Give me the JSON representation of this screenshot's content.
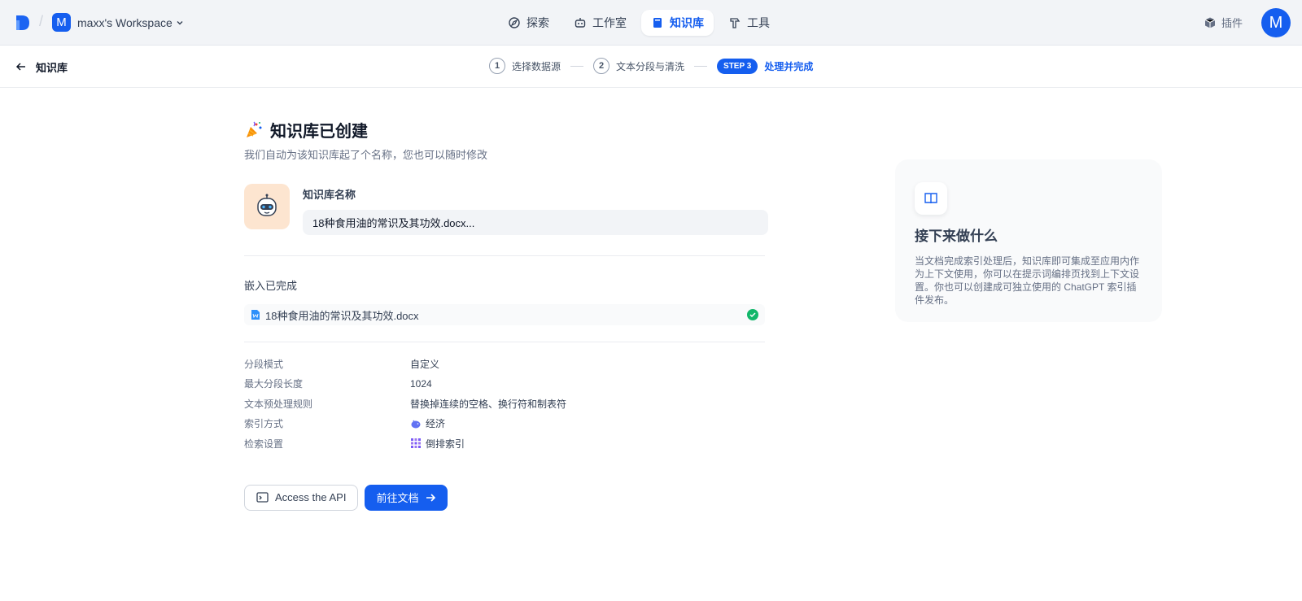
{
  "topbar": {
    "workspace_initial": "M",
    "workspace_name": "maxx's Workspace",
    "nav": [
      {
        "label": "探索",
        "icon": "compass-icon"
      },
      {
        "label": "工作室",
        "icon": "robot-icon"
      },
      {
        "label": "知识库",
        "icon": "book-icon",
        "active": true
      },
      {
        "label": "工具",
        "icon": "hammer-icon"
      }
    ],
    "plugin_label": "插件",
    "user_initial": "M"
  },
  "subbar": {
    "title": "知识库",
    "steps": [
      {
        "num": "1",
        "label": "选择数据源"
      },
      {
        "num": "2",
        "label": "文本分段与清洗"
      },
      {
        "badge": "STEP 3",
        "label": "处理并完成"
      }
    ]
  },
  "main": {
    "title": "知识库已创建",
    "subtitle": "我们自动为该知识库起了个名称，您也可以随时修改",
    "name_label": "知识库名称",
    "name_value": "18种食用油的常识及其功效.docx...",
    "embedding_title": "嵌入已完成",
    "file_name": "18种食用油的常识及其功效.docx",
    "props": [
      {
        "key": "分段模式",
        "value": "自定义"
      },
      {
        "key": "最大分段长度",
        "value": "1024"
      },
      {
        "key": "文本预处理规则",
        "value": "替换掉连续的空格、换行符和制表符"
      },
      {
        "key": "索引方式",
        "value": "经济",
        "icon": "piggy-bank-icon"
      },
      {
        "key": "检索设置",
        "value": "倒排索引",
        "icon": "grid-icon"
      }
    ],
    "api_button": "Access the API",
    "docs_button": "前往文档"
  },
  "panel": {
    "title": "接下来做什么",
    "text": "当文档完成索引处理后，知识库即可集成至应用内作为上下文使用，你可以在提示词编排页找到上下文设置。你也可以创建成可独立使用的 ChatGPT 索引插件发布。"
  },
  "colors": {
    "accent": "#155eef",
    "success": "#12b76a"
  }
}
